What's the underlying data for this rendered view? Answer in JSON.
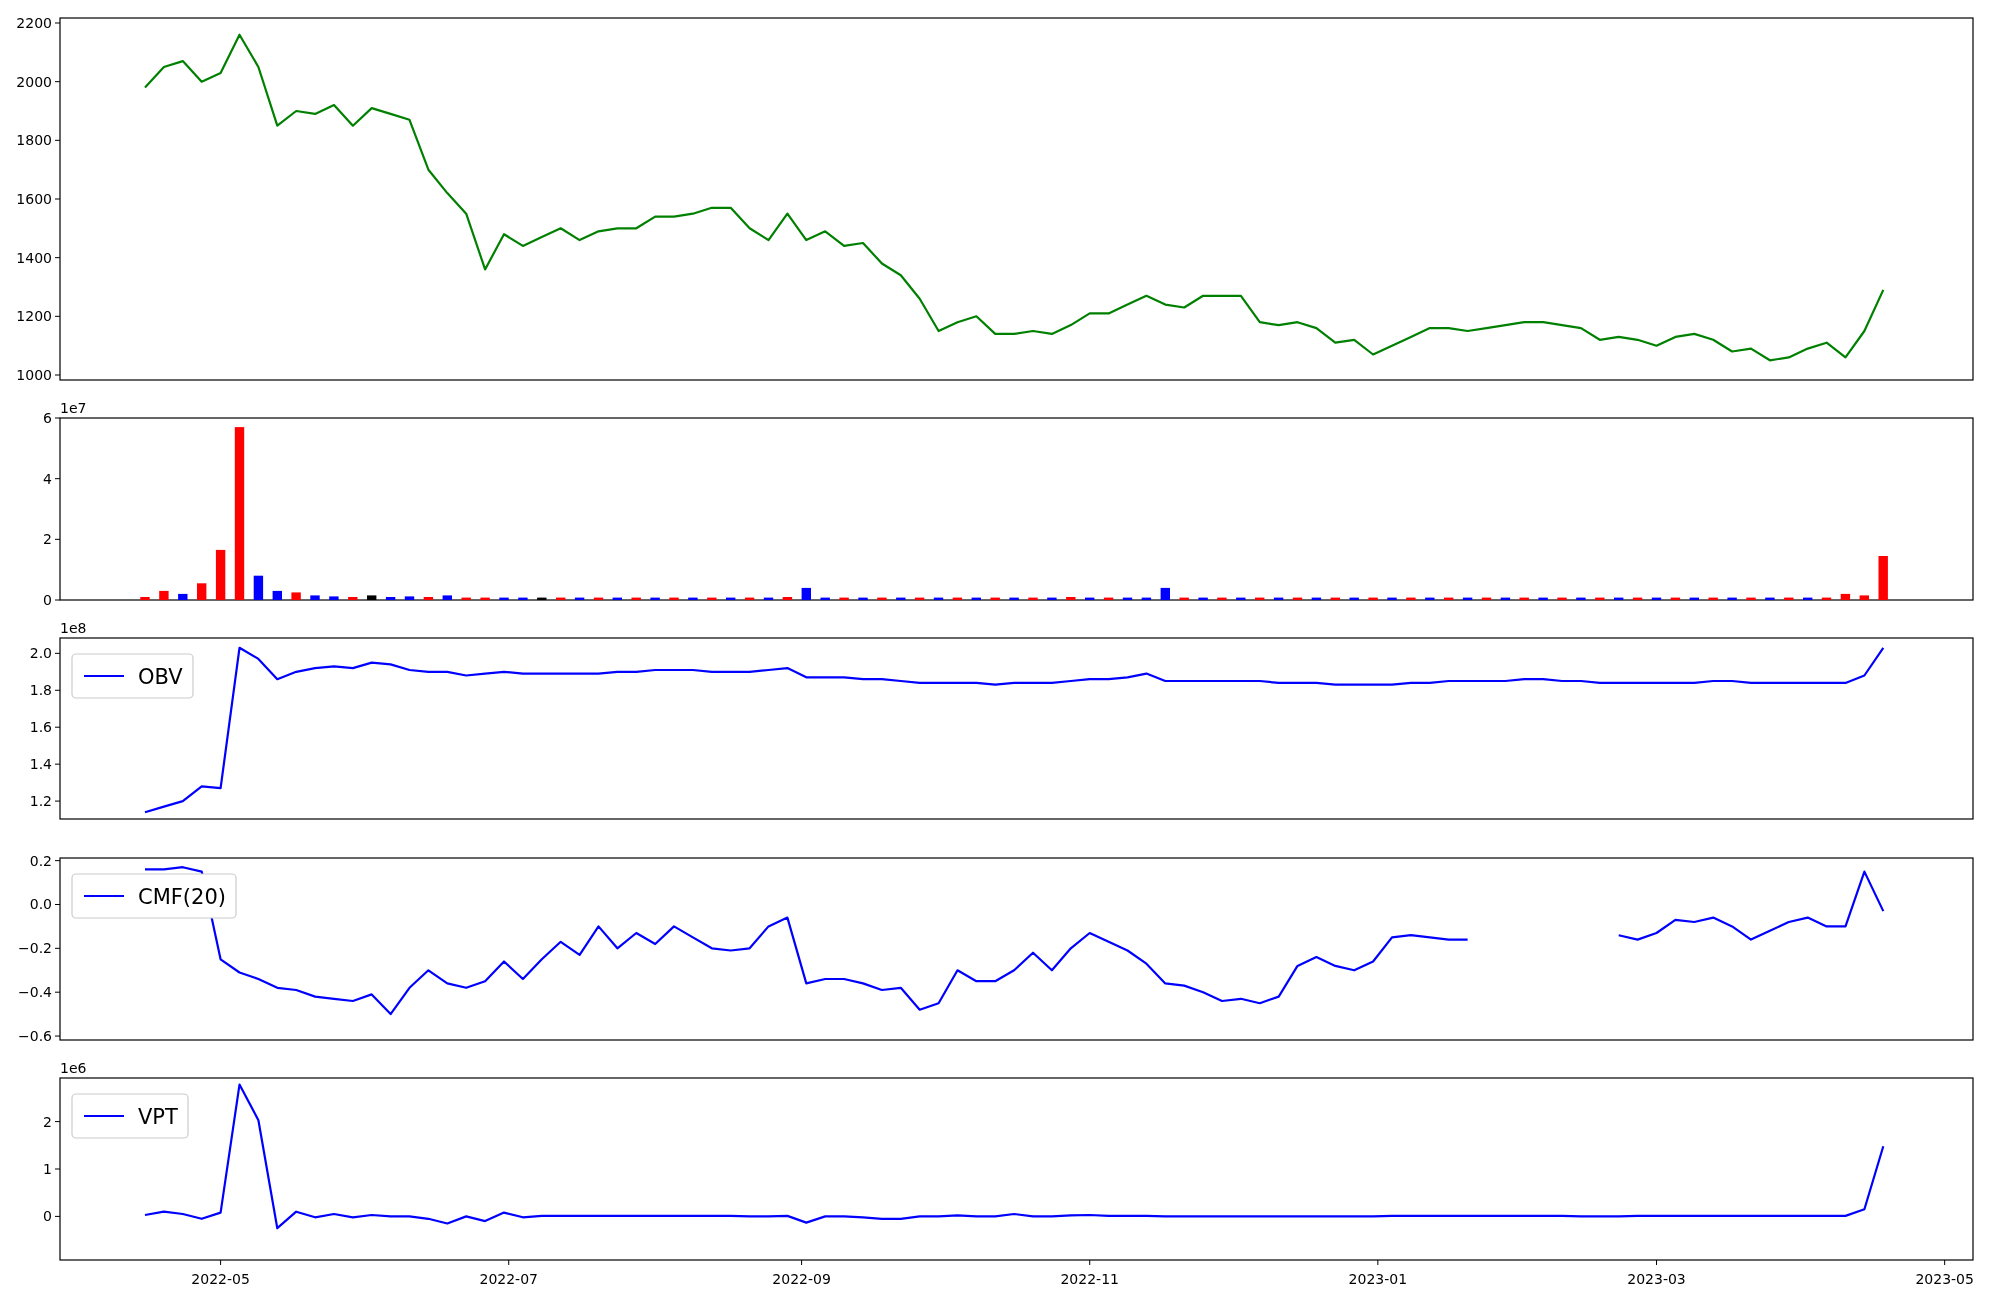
{
  "figure": {
    "panels": [
      {
        "chart_data": {
          "type": "line",
          "x": [
            "2022-04-15",
            "2022-04-19",
            "2022-04-23",
            "2022-04-27",
            "2022-05-01",
            "2022-05-05",
            "2022-05-09",
            "2022-05-13",
            "2022-05-17",
            "2022-05-21",
            "2022-05-25",
            "2022-05-29",
            "2022-06-02",
            "2022-06-06",
            "2022-06-10",
            "2022-06-14",
            "2022-06-18",
            "2022-06-22",
            "2022-06-26",
            "2022-06-30",
            "2022-07-04",
            "2022-07-08",
            "2022-07-12",
            "2022-07-16",
            "2022-07-20",
            "2022-07-24",
            "2022-07-28",
            "2022-08-01",
            "2022-08-05",
            "2022-08-09",
            "2022-08-13",
            "2022-08-17",
            "2022-08-21",
            "2022-08-25",
            "2022-08-29",
            "2022-09-02",
            "2022-09-06",
            "2022-09-10",
            "2022-09-14",
            "2022-09-18",
            "2022-09-22",
            "2022-09-26",
            "2022-09-30",
            "2022-10-04",
            "2022-10-08",
            "2022-10-12",
            "2022-10-16",
            "2022-10-20",
            "2022-10-24",
            "2022-10-28",
            "2022-11-01",
            "2022-11-05",
            "2022-11-09",
            "2022-11-13",
            "2022-11-17",
            "2022-11-21",
            "2022-11-25",
            "2022-11-29",
            "2022-12-03",
            "2022-12-07",
            "2022-12-11",
            "2022-12-15",
            "2022-12-19",
            "2022-12-23",
            "2022-12-27",
            "2022-12-31",
            "2023-01-04",
            "2023-01-08",
            "2023-01-12",
            "2023-01-16",
            "2023-01-20",
            "2023-01-24",
            "2023-01-28",
            "2023-02-01",
            "2023-02-05",
            "2023-02-09",
            "2023-02-13",
            "2023-02-17",
            "2023-02-21",
            "2023-02-25",
            "2023-03-01",
            "2023-03-05",
            "2023-03-09",
            "2023-03-13",
            "2023-03-17",
            "2023-03-21",
            "2023-03-25",
            "2023-03-29",
            "2023-04-02",
            "2023-04-06",
            "2023-04-10",
            "2023-04-14",
            "2023-04-18"
          ],
          "series": [
            {
              "color": "#008000",
              "values": [
                1980,
                2050,
                2070,
                2000,
                2030,
                2160,
                2050,
                1850,
                1900,
                1890,
                1920,
                1850,
                1910,
                1890,
                1870,
                1700,
                1620,
                1550,
                1360,
                1480,
                1440,
                1470,
                1500,
                1460,
                1490,
                1500,
                1500,
                1540,
                1540,
                1550,
                1570,
                1570,
                1500,
                1460,
                1550,
                1460,
                1490,
                1440,
                1450,
                1380,
                1340,
                1260,
                1150,
                1180,
                1200,
                1140,
                1140,
                1150,
                1140,
                1170,
                1210,
                1210,
                1240,
                1270,
                1240,
                1230,
                1270,
                1270,
                1270,
                1180,
                1170,
                1180,
                1160,
                1110,
                1120,
                1070,
                1100,
                1130,
                1160,
                1160,
                1150,
                1160,
                1170,
                1180,
                1180,
                1170,
                1160,
                1120,
                1130,
                1120,
                1100,
                1130,
                1140,
                1120,
                1080,
                1090,
                1050,
                1060,
                1090,
                1110,
                1060,
                1150,
                1290
              ]
            }
          ],
          "xlim": [
            "2022-03-28",
            "2023-05-07"
          ],
          "ylim": [
            983,
            2217
          ],
          "yticks": [
            1000,
            1200,
            1400,
            1600,
            1800,
            2000,
            2200
          ]
        }
      },
      {
        "offset_text": "1e7",
        "chart_data": {
          "type": "bar",
          "x": [
            "2022-04-15",
            "2022-04-19",
            "2022-04-23",
            "2022-04-27",
            "2022-05-01",
            "2022-05-05",
            "2022-05-09",
            "2022-05-13",
            "2022-05-17",
            "2022-05-21",
            "2022-05-25",
            "2022-05-29",
            "2022-06-02",
            "2022-06-06",
            "2022-06-10",
            "2022-06-14",
            "2022-06-18",
            "2022-06-22",
            "2022-06-26",
            "2022-06-30",
            "2022-07-04",
            "2022-07-08",
            "2022-07-12",
            "2022-07-16",
            "2022-07-20",
            "2022-07-24",
            "2022-07-28",
            "2022-08-01",
            "2022-08-05",
            "2022-08-09",
            "2022-08-13",
            "2022-08-17",
            "2022-08-21",
            "2022-08-25",
            "2022-08-29",
            "2022-09-02",
            "2022-09-06",
            "2022-09-10",
            "2022-09-14",
            "2022-09-18",
            "2022-09-22",
            "2022-09-26",
            "2022-09-30",
            "2022-10-04",
            "2022-10-08",
            "2022-10-12",
            "2022-10-16",
            "2022-10-20",
            "2022-10-24",
            "2022-10-28",
            "2022-11-01",
            "2022-11-05",
            "2022-11-09",
            "2022-11-13",
            "2022-11-17",
            "2022-11-21",
            "2022-11-25",
            "2022-11-29",
            "2022-12-03",
            "2022-12-07",
            "2022-12-11",
            "2022-12-15",
            "2022-12-19",
            "2022-12-23",
            "2022-12-27",
            "2022-12-31",
            "2023-01-04",
            "2023-01-08",
            "2023-01-12",
            "2023-01-16",
            "2023-01-20",
            "2023-01-24",
            "2023-01-28",
            "2023-02-01",
            "2023-02-05",
            "2023-02-09",
            "2023-02-13",
            "2023-02-17",
            "2023-02-21",
            "2023-02-25",
            "2023-03-01",
            "2023-03-05",
            "2023-03-09",
            "2023-03-13",
            "2023-03-17",
            "2023-03-21",
            "2023-03-25",
            "2023-03-29",
            "2023-04-02",
            "2023-04-06",
            "2023-04-10",
            "2023-04-14",
            "2023-04-18"
          ],
          "series": [
            {
              "color": "#ff0000",
              "values": [
                0.1,
                0.3,
                null,
                0.55,
                1.65,
                5.7,
                null,
                null,
                0.25,
                null,
                null,
                0.1,
                null,
                null,
                null,
                0.1,
                null,
                0.08,
                0.08,
                null,
                null,
                null,
                0.08,
                null,
                0.08,
                null,
                0.08,
                null,
                0.08,
                null,
                0.08,
                null,
                0.08,
                null,
                0.1,
                null,
                null,
                0.08,
                null,
                0.08,
                null,
                0.08,
                null,
                0.08,
                null,
                0.08,
                null,
                0.08,
                null,
                0.1,
                null,
                0.08,
                null,
                null,
                null,
                0.08,
                null,
                0.08,
                null,
                0.08,
                null,
                0.08,
                null,
                0.08,
                null,
                0.08,
                null,
                0.08,
                null,
                0.08,
                null,
                0.08,
                null,
                0.08,
                null,
                0.08,
                null,
                0.08,
                null,
                0.08,
                null,
                0.08,
                null,
                0.08,
                null,
                0.08,
                null,
                0.08,
                null,
                0.08,
                0.2,
                0.15,
                1.45
              ]
            },
            {
              "color": "#0000ff",
              "values": [
                null,
                null,
                0.2,
                null,
                null,
                null,
                0.8,
                0.3,
                null,
                0.15,
                0.12,
                null,
                null,
                0.1,
                0.12,
                null,
                0.15,
                null,
                null,
                0.08,
                0.08,
                null,
                null,
                0.08,
                null,
                0.08,
                null,
                0.08,
                null,
                0.08,
                null,
                0.08,
                null,
                0.08,
                null,
                0.4,
                0.08,
                null,
                0.08,
                null,
                0.08,
                null,
                0.08,
                null,
                0.08,
                null,
                0.08,
                null,
                0.08,
                null,
                0.08,
                null,
                0.08,
                0.08,
                0.4,
                null,
                0.08,
                null,
                0.08,
                null,
                0.08,
                null,
                0.08,
                null,
                0.08,
                null,
                0.08,
                null,
                0.08,
                null,
                0.08,
                null,
                0.08,
                null,
                0.08,
                null,
                0.08,
                null,
                0.08,
                null,
                0.08,
                null,
                0.08,
                null,
                0.08,
                null,
                0.08,
                null,
                0.08,
                null,
                null,
                null,
                null
              ]
            },
            {
              "color": "#000000",
              "values": [
                null,
                null,
                null,
                null,
                null,
                null,
                null,
                null,
                null,
                null,
                null,
                null,
                0.15,
                null,
                null,
                null,
                null,
                null,
                null,
                null,
                null,
                0.08,
                null,
                null,
                null,
                null,
                null,
                null,
                null,
                null,
                null,
                null,
                null,
                null,
                null,
                null,
                null,
                null,
                null,
                null,
                null,
                null,
                null,
                null,
                null,
                null,
                null,
                null,
                null,
                null,
                null,
                null,
                null,
                null,
                null,
                null,
                null,
                null,
                null,
                null,
                null,
                null,
                null,
                null,
                null,
                null,
                null,
                null,
                null,
                null,
                null,
                null,
                null,
                null,
                null,
                null,
                null,
                null,
                null,
                null,
                null,
                null,
                null,
                null,
                null,
                null,
                null,
                null,
                null,
                null,
                null,
                null,
                null
              ]
            }
          ],
          "xlim": [
            "2022-03-28",
            "2023-05-07"
          ],
          "ylim": [
            0,
            6
          ],
          "yticks": [
            0,
            2,
            4,
            6
          ]
        }
      },
      {
        "offset_text": "1e8",
        "chart_data": {
          "type": "line",
          "x": [
            "2022-04-15",
            "2022-04-19",
            "2022-04-23",
            "2022-04-27",
            "2022-05-01",
            "2022-05-05",
            "2022-05-09",
            "2022-05-13",
            "2022-05-17",
            "2022-05-21",
            "2022-05-25",
            "2022-05-29",
            "2022-06-02",
            "2022-06-06",
            "2022-06-10",
            "2022-06-14",
            "2022-06-18",
            "2022-06-22",
            "2022-06-26",
            "2022-06-30",
            "2022-07-04",
            "2022-07-08",
            "2022-07-12",
            "2022-07-16",
            "2022-07-20",
            "2022-07-24",
            "2022-07-28",
            "2022-08-01",
            "2022-08-05",
            "2022-08-09",
            "2022-08-13",
            "2022-08-17",
            "2022-08-21",
            "2022-08-25",
            "2022-08-29",
            "2022-09-02",
            "2022-09-06",
            "2022-09-10",
            "2022-09-14",
            "2022-09-18",
            "2022-09-22",
            "2022-09-26",
            "2022-09-30",
            "2022-10-04",
            "2022-10-08",
            "2022-10-12",
            "2022-10-16",
            "2022-10-20",
            "2022-10-24",
            "2022-10-28",
            "2022-11-01",
            "2022-11-05",
            "2022-11-09",
            "2022-11-13",
            "2022-11-17",
            "2022-11-21",
            "2022-11-25",
            "2022-11-29",
            "2022-12-03",
            "2022-12-07",
            "2022-12-11",
            "2022-12-15",
            "2022-12-19",
            "2022-12-23",
            "2022-12-27",
            "2022-12-31",
            "2023-01-04",
            "2023-01-08",
            "2023-01-12",
            "2023-01-16",
            "2023-01-20",
            "2023-01-24",
            "2023-01-28",
            "2023-02-01",
            "2023-02-05",
            "2023-02-09",
            "2023-02-13",
            "2023-02-17",
            "2023-02-21",
            "2023-02-25",
            "2023-03-01",
            "2023-03-05",
            "2023-03-09",
            "2023-03-13",
            "2023-03-17",
            "2023-03-21",
            "2023-03-25",
            "2023-03-29",
            "2023-04-02",
            "2023-04-06",
            "2023-04-10",
            "2023-04-14",
            "2023-04-18"
          ],
          "series": [
            {
              "name": "OBV",
              "color": "#0000ff",
              "values": [
                1.14,
                1.17,
                1.2,
                1.28,
                1.27,
                2.03,
                1.97,
                1.86,
                1.9,
                1.92,
                1.93,
                1.92,
                1.95,
                1.94,
                1.91,
                1.9,
                1.9,
                1.88,
                1.89,
                1.9,
                1.89,
                1.89,
                1.89,
                1.89,
                1.89,
                1.9,
                1.9,
                1.91,
                1.91,
                1.91,
                1.9,
                1.9,
                1.9,
                1.91,
                1.92,
                1.87,
                1.87,
                1.87,
                1.86,
                1.86,
                1.85,
                1.84,
                1.84,
                1.84,
                1.84,
                1.83,
                1.84,
                1.84,
                1.84,
                1.85,
                1.86,
                1.86,
                1.87,
                1.89,
                1.85,
                1.85,
                1.85,
                1.85,
                1.85,
                1.85,
                1.84,
                1.84,
                1.84,
                1.83,
                1.83,
                1.83,
                1.83,
                1.84,
                1.84,
                1.85,
                1.85,
                1.85,
                1.85,
                1.86,
                1.86,
                1.85,
                1.85,
                1.84,
                1.84,
                1.84,
                1.84,
                1.84,
                1.84,
                1.85,
                1.85,
                1.84,
                1.84,
                1.84,
                1.84,
                1.84,
                1.84,
                1.88,
                2.03
              ]
            }
          ],
          "xlim": [
            "2022-03-28",
            "2023-05-07"
          ],
          "ylim": [
            1.103,
            2.083
          ],
          "yticks": [
            {
              "value": 1.2,
              "label": "1.2"
            },
            {
              "value": 1.4,
              "label": "1.4"
            },
            {
              "value": 1.6,
              "label": "1.6"
            },
            {
              "value": 1.8,
              "label": "1.8"
            },
            {
              "value": 2.0,
              "label": "2.0"
            }
          ]
        }
      },
      {
        "chart_data": {
          "type": "line",
          "x": [
            "2022-04-15",
            "2022-04-19",
            "2022-04-23",
            "2022-04-27",
            "2022-05-01",
            "2022-05-05",
            "2022-05-09",
            "2022-05-13",
            "2022-05-17",
            "2022-05-21",
            "2022-05-25",
            "2022-05-29",
            "2022-06-02",
            "2022-06-06",
            "2022-06-10",
            "2022-06-14",
            "2022-06-18",
            "2022-06-22",
            "2022-06-26",
            "2022-06-30",
            "2022-07-04",
            "2022-07-08",
            "2022-07-12",
            "2022-07-16",
            "2022-07-20",
            "2022-07-24",
            "2022-07-28",
            "2022-08-01",
            "2022-08-05",
            "2022-08-09",
            "2022-08-13",
            "2022-08-17",
            "2022-08-21",
            "2022-08-25",
            "2022-08-29",
            "2022-09-02",
            "2022-09-06",
            "2022-09-10",
            "2022-09-14",
            "2022-09-18",
            "2022-09-22",
            "2022-09-26",
            "2022-09-30",
            "2022-10-04",
            "2022-10-08",
            "2022-10-12",
            "2022-10-16",
            "2022-10-20",
            "2022-10-24",
            "2022-10-28",
            "2022-11-01",
            "2022-11-05",
            "2022-11-09",
            "2022-11-13",
            "2022-11-17",
            "2022-11-21",
            "2022-11-25",
            "2022-11-29",
            "2022-12-03",
            "2022-12-07",
            "2022-12-11",
            "2022-12-15",
            "2022-12-19",
            "2022-12-23",
            "2022-12-27",
            "2022-12-31",
            "2023-01-04",
            "2023-01-08",
            "2023-01-12",
            "2023-01-16",
            "2023-01-20",
            "2023-02-21",
            "2023-02-25",
            "2023-03-01",
            "2023-03-05",
            "2023-03-09",
            "2023-03-13",
            "2023-03-17",
            "2023-03-21",
            "2023-03-25",
            "2023-03-29",
            "2023-04-02",
            "2023-04-06",
            "2023-04-10",
            "2023-04-14",
            "2023-04-18"
          ],
          "series": [
            {
              "name": "CMF(20)",
              "color": "#0000ff",
              "values": [
                0.16,
                0.16,
                0.17,
                0.15,
                -0.25,
                -0.31,
                -0.34,
                -0.38,
                -0.39,
                -0.42,
                -0.43,
                -0.44,
                -0.41,
                -0.5,
                -0.38,
                -0.3,
                -0.36,
                -0.38,
                -0.35,
                -0.26,
                -0.34,
                -0.25,
                -0.17,
                -0.23,
                -0.1,
                -0.2,
                -0.13,
                -0.18,
                -0.1,
                -0.15,
                -0.2,
                -0.21,
                -0.2,
                -0.1,
                -0.06,
                -0.36,
                -0.34,
                -0.34,
                -0.36,
                -0.39,
                -0.38,
                -0.48,
                -0.45,
                -0.3,
                -0.35,
                -0.35,
                -0.3,
                -0.22,
                -0.3,
                -0.2,
                -0.13,
                -0.17,
                -0.21,
                -0.27,
                -0.36,
                -0.37,
                -0.4,
                -0.44,
                -0.43,
                -0.45,
                -0.42,
                -0.28,
                -0.24,
                -0.28,
                -0.3,
                -0.26,
                -0.15,
                -0.14,
                -0.15,
                -0.16,
                -0.16,
                -0.14,
                -0.16,
                -0.13,
                -0.07,
                -0.08,
                -0.06,
                -0.1,
                -0.16,
                -0.12,
                -0.08,
                -0.06,
                -0.1,
                -0.1,
                0.15,
                -0.03
              ]
            }
          ],
          "xlim": [
            "2022-03-28",
            "2023-05-07"
          ],
          "ylim": [
            -0.618,
            0.212
          ],
          "yticks": [
            {
              "value": 0.2,
              "label": "0.2"
            },
            {
              "value": 0,
              "label": "0.0"
            },
            {
              "value": -0.2,
              "label": "−0.2"
            },
            {
              "value": -0.4,
              "label": "−0.4"
            },
            {
              "value": -0.6,
              "label": "−0.6"
            }
          ]
        }
      },
      {
        "offset_text": "1e6",
        "chart_data": {
          "type": "line",
          "x": [
            "2022-04-15",
            "2022-04-19",
            "2022-04-23",
            "2022-04-27",
            "2022-05-01",
            "2022-05-05",
            "2022-05-09",
            "2022-05-13",
            "2022-05-17",
            "2022-05-21",
            "2022-05-25",
            "2022-05-29",
            "2022-06-02",
            "2022-06-06",
            "2022-06-10",
            "2022-06-14",
            "2022-06-18",
            "2022-06-22",
            "2022-06-26",
            "2022-06-30",
            "2022-07-04",
            "2022-07-08",
            "2022-07-12",
            "2022-07-16",
            "2022-07-20",
            "2022-07-24",
            "2022-07-28",
            "2022-08-01",
            "2022-08-05",
            "2022-08-09",
            "2022-08-13",
            "2022-08-17",
            "2022-08-21",
            "2022-08-25",
            "2022-08-29",
            "2022-09-02",
            "2022-09-06",
            "2022-09-10",
            "2022-09-14",
            "2022-09-18",
            "2022-09-22",
            "2022-09-26",
            "2022-09-30",
            "2022-10-04",
            "2022-10-08",
            "2022-10-12",
            "2022-10-16",
            "2022-10-20",
            "2022-10-24",
            "2022-10-28",
            "2022-11-01",
            "2022-11-05",
            "2022-11-09",
            "2022-11-13",
            "2022-11-17",
            "2022-11-21",
            "2022-11-25",
            "2022-11-29",
            "2022-12-03",
            "2022-12-07",
            "2022-12-11",
            "2022-12-15",
            "2022-12-19",
            "2022-12-23",
            "2022-12-27",
            "2022-12-31",
            "2023-01-04",
            "2023-01-08",
            "2023-01-12",
            "2023-01-16",
            "2023-01-20",
            "2023-01-24",
            "2023-01-28",
            "2023-02-01",
            "2023-02-05",
            "2023-02-09",
            "2023-02-13",
            "2023-02-17",
            "2023-02-21",
            "2023-02-25",
            "2023-03-01",
            "2023-03-05",
            "2023-03-09",
            "2023-03-13",
            "2023-03-17",
            "2023-03-21",
            "2023-03-25",
            "2023-03-29",
            "2023-04-02",
            "2023-04-06",
            "2023-04-10",
            "2023-04-14",
            "2023-04-18"
          ],
          "series": [
            {
              "name": "VPT",
              "color": "#0000ff",
              "values": [
                0.03,
                0.1,
                0.05,
                -0.05,
                0.08,
                2.78,
                2.03,
                -0.25,
                0.1,
                -0.02,
                0.05,
                -0.02,
                0.03,
                0,
                0,
                -0.05,
                -0.15,
                0,
                -0.1,
                0.08,
                -0.02,
                0.01,
                0.01,
                0.01,
                0.01,
                0.01,
                0.01,
                0.01,
                0.01,
                0.01,
                0.01,
                0.01,
                0,
                0,
                0.01,
                -0.13,
                0,
                0,
                -0.02,
                -0.05,
                -0.05,
                0,
                0,
                0.02,
                0,
                0,
                0.05,
                0,
                0,
                0.02,
                0.03,
                0.01,
                0.01,
                0.01,
                0,
                0,
                0,
                0,
                0,
                0,
                0,
                0,
                0,
                0,
                0,
                0,
                0.01,
                0.01,
                0.01,
                0.01,
                0.01,
                0.01,
                0.01,
                0.01,
                0.01,
                0.01,
                0,
                0,
                0,
                0.01,
                0.01,
                0.01,
                0.01,
                0.01,
                0.01,
                0.01,
                0.01,
                0.01,
                0.01,
                0.01,
                0.01,
                0.15,
                1.48
              ]
            }
          ],
          "xlim": [
            "2022-03-28",
            "2023-05-07"
          ],
          "ylim": [
            -0.92,
            2.92
          ],
          "yticks": [
            0,
            1,
            2
          ],
          "xticks": [
            {
              "value": "2022-05-01",
              "label": "2022-05"
            },
            {
              "value": "2022-07-01",
              "label": "2022-07"
            },
            {
              "value": "2022-09-01",
              "label": "2022-09"
            },
            {
              "value": "2022-11-01",
              "label": "2022-11"
            },
            {
              "value": "2023-01-01",
              "label": "2023-01"
            },
            {
              "value": "2023-03-01",
              "label": "2023-03"
            },
            {
              "value": "2023-05-01",
              "label": "2023-05"
            }
          ]
        }
      }
    ]
  }
}
